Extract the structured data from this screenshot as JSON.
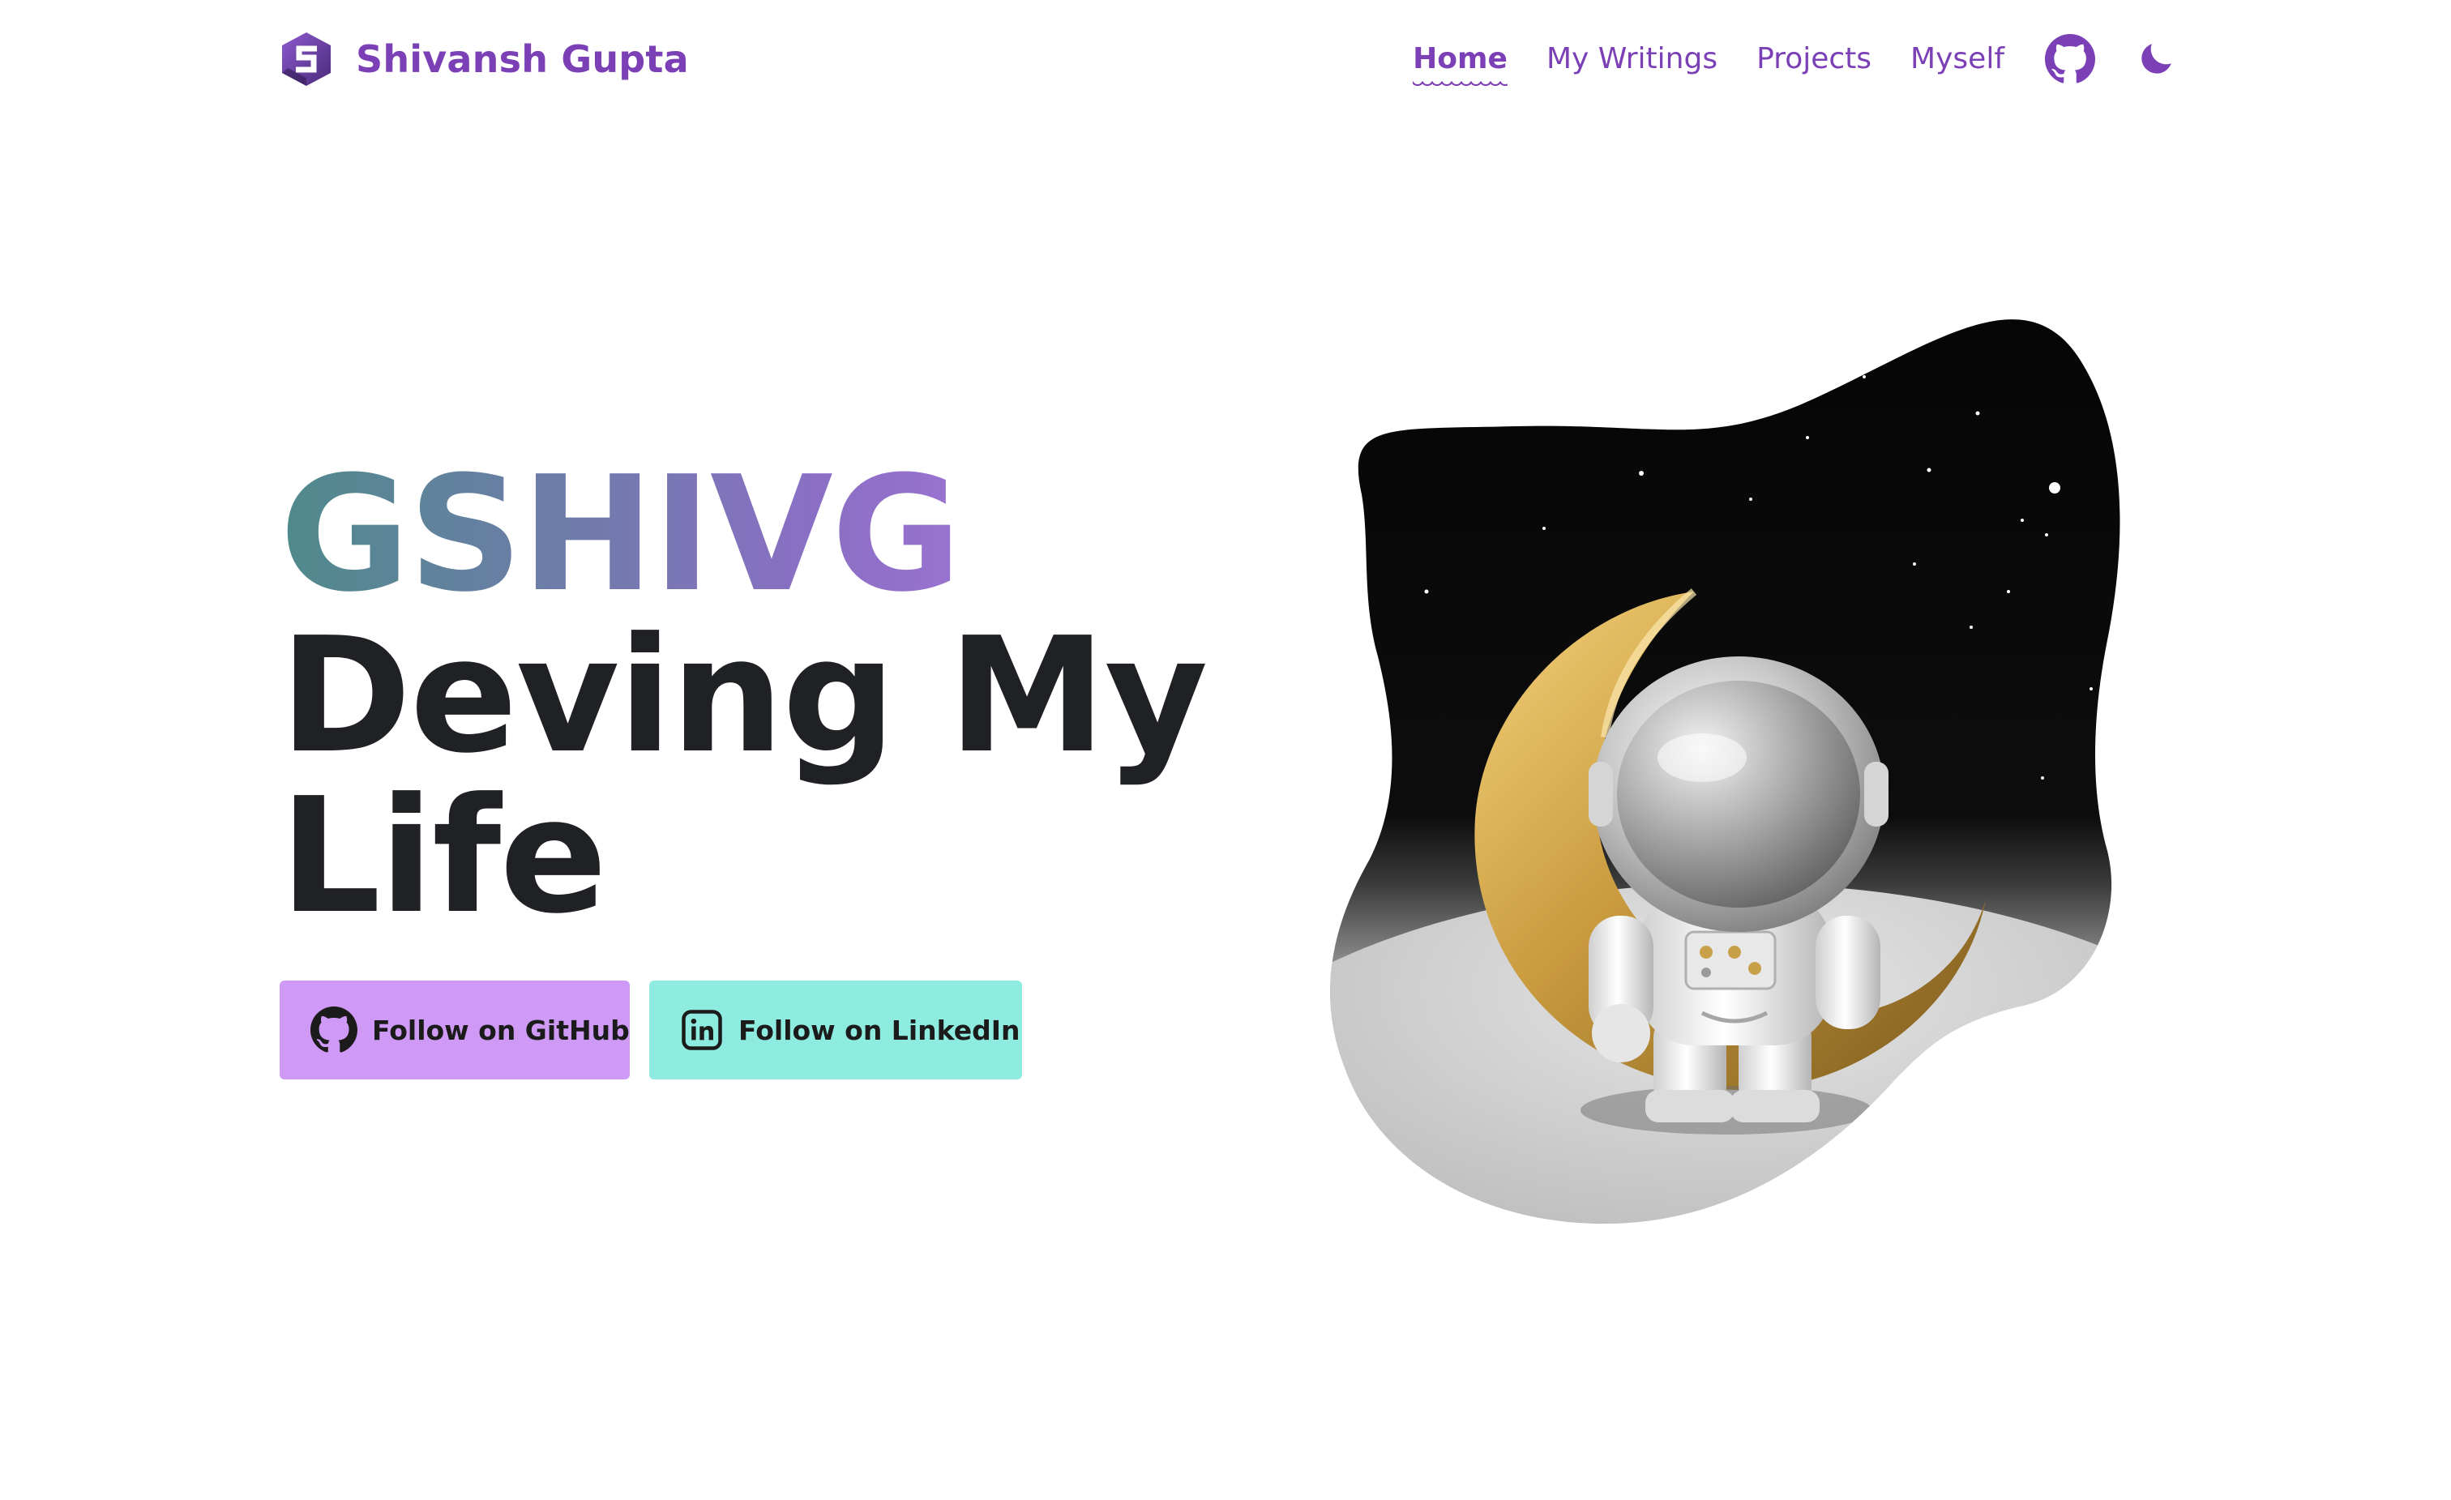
{
  "brand": {
    "name": "Shivansh Gupta",
    "logo_icon": "s-hexagon-logo-icon"
  },
  "nav": {
    "links": [
      {
        "label": "Home",
        "active": true
      },
      {
        "label": "My Writings",
        "active": false
      },
      {
        "label": "Projects",
        "active": false
      },
      {
        "label": "Myself",
        "active": false
      }
    ],
    "github_icon": "github-icon",
    "theme_icon": "moon-icon"
  },
  "hero": {
    "handle": "GSHIVG",
    "tagline": "Deving My Life",
    "image_alt": "astronaut-on-moon-illustration"
  },
  "cta": {
    "github_label": "Follow on GitHub",
    "linkedin_label": "Follow on LinkedIn"
  },
  "colors": {
    "accent": "#7b3fb6",
    "github_button": "#cf9af5",
    "linkedin_button": "#8eebdf",
    "text": "#202124"
  }
}
